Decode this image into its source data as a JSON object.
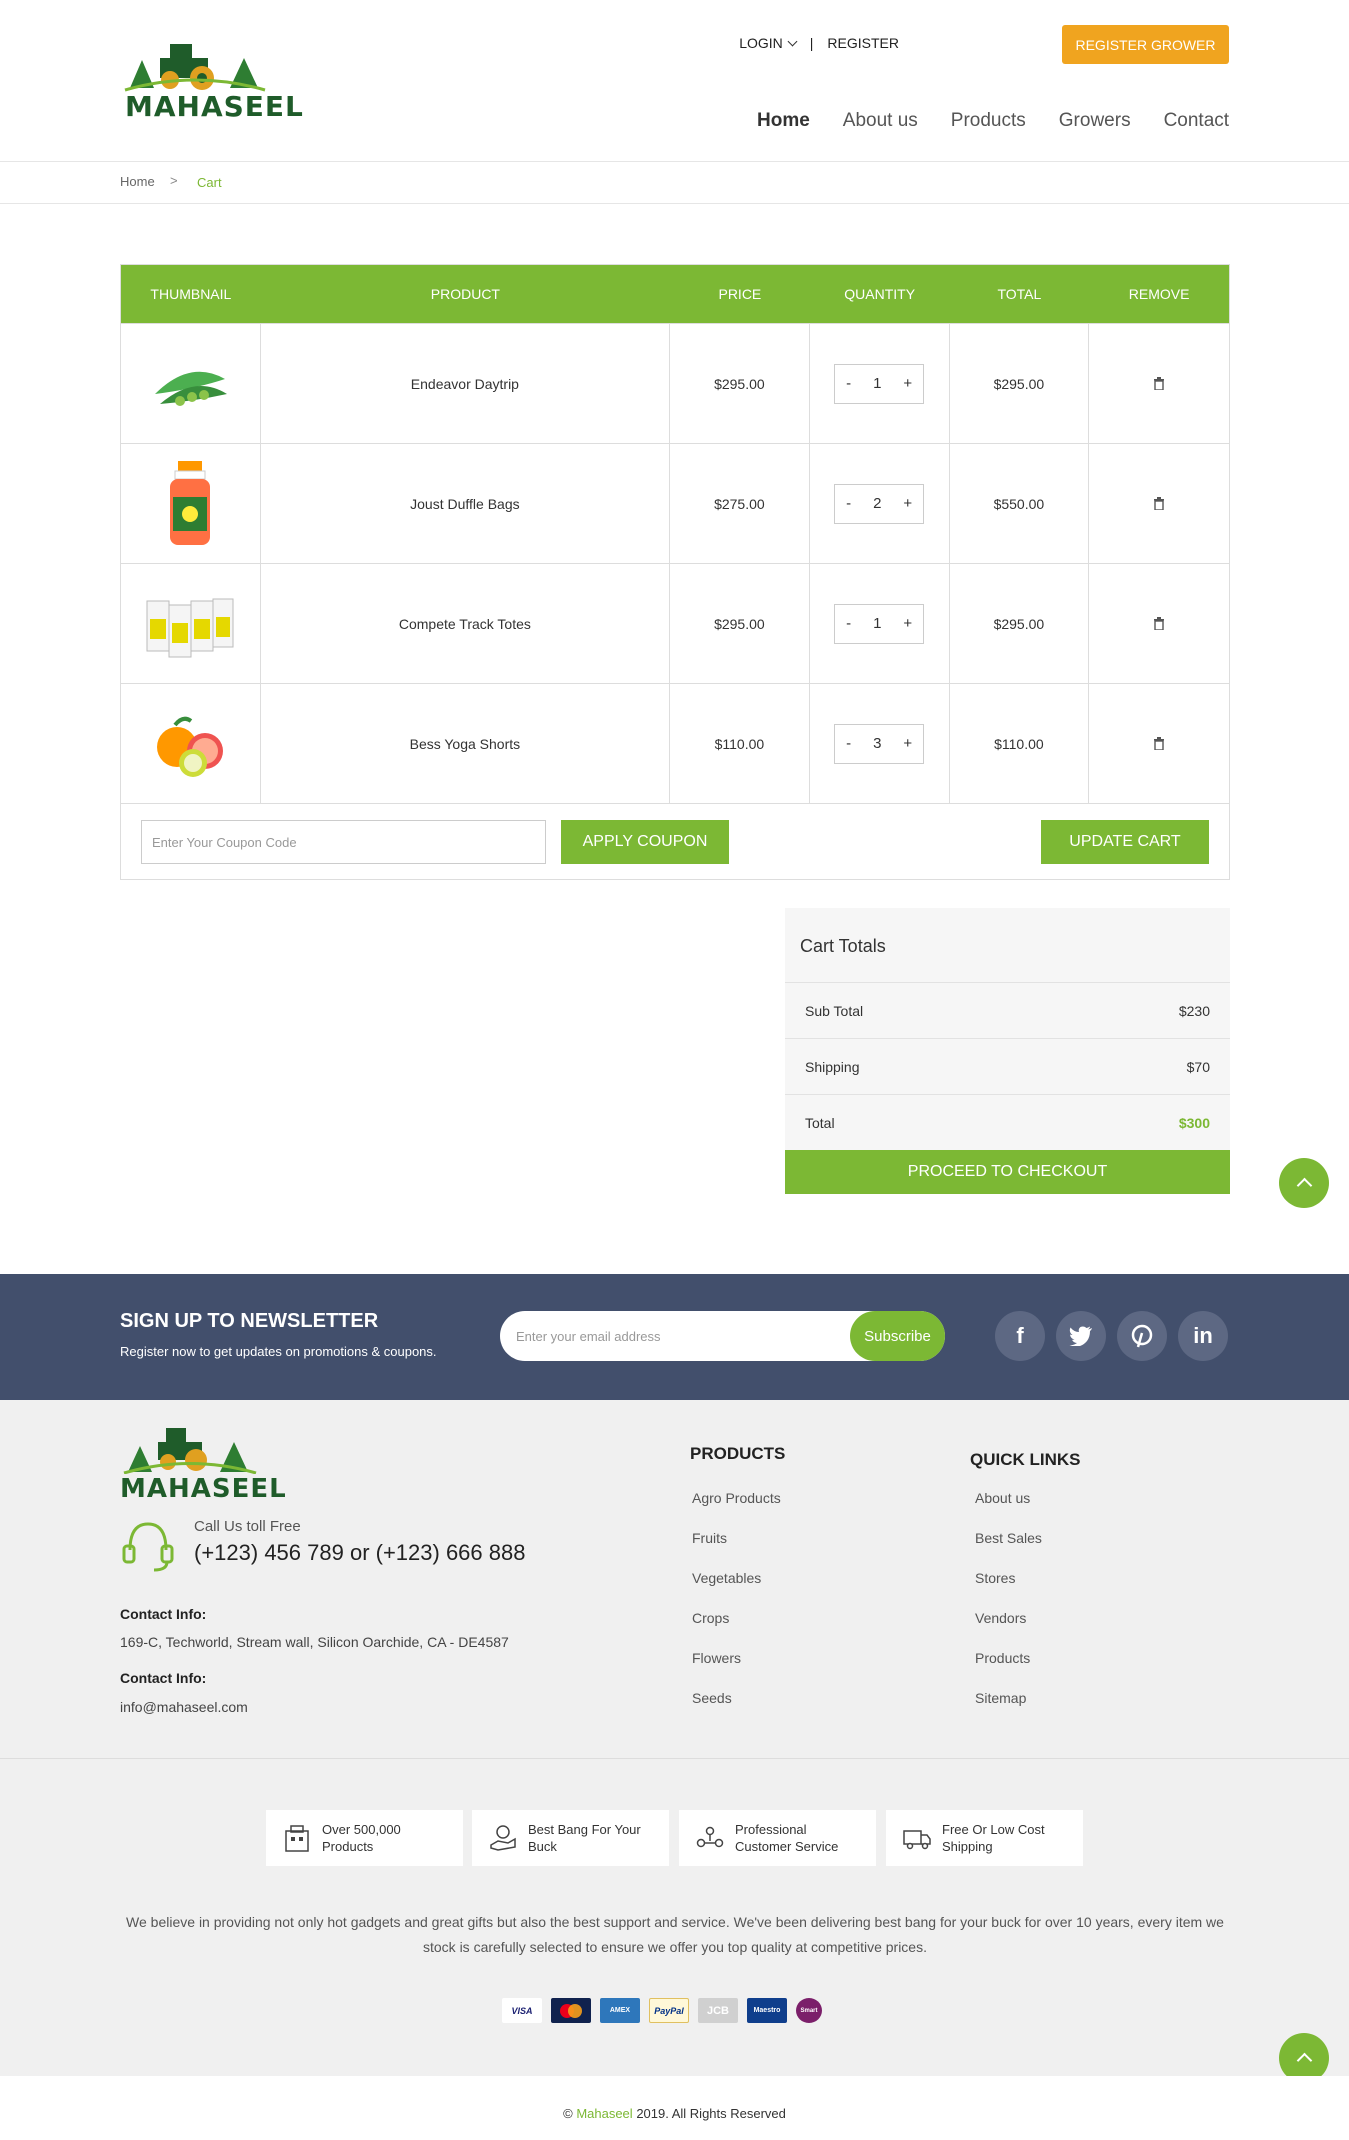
{
  "header": {
    "brand": "MAHASEEL",
    "login": "LOGIN",
    "register": "REGISTER",
    "register_grower": "REGISTER GROWER",
    "nav": [
      "Home",
      "About us",
      "Products",
      "Growers",
      "Contact"
    ]
  },
  "breadcrumb": {
    "home": "Home",
    "sep": ">",
    "current": "Cart"
  },
  "cart": {
    "headers": [
      "THUMBNAIL",
      "PRODUCT",
      "PRICE",
      "QUANTITY",
      "TOTAL",
      "REMOVE"
    ],
    "rows": [
      {
        "product": "Endeavor Daytrip",
        "price": "$295.00",
        "qty": "1",
        "total": "$295.00"
      },
      {
        "product": "Joust Duffle Bags",
        "price": "$275.00",
        "qty": "2",
        "total": "$550.00"
      },
      {
        "product": "Compete Track Totes",
        "price": "$295.00",
        "qty": "1",
        "total": "$295.00"
      },
      {
        "product": "Bess Yoga Shorts",
        "price": "$110.00",
        "qty": "3",
        "total": "$110.00"
      }
    ],
    "qty_minus": "-",
    "qty_plus": "+",
    "coupon_placeholder": "Enter Your Coupon Code",
    "apply_coupon": "APPLY COUPON",
    "update_cart": "UPDATE CART"
  },
  "totals": {
    "title": "Cart Totals",
    "subtotal_label": "Sub Total",
    "subtotal": "$230",
    "shipping_label": "Shipping",
    "shipping": "$70",
    "total_label": "Total",
    "total": "$300",
    "checkout": "PROCEED TO CHECKOUT"
  },
  "newsletter": {
    "title": "SIGN UP TO NEWSLETTER",
    "subtitle": "Register now to get updates on promotions & coupons.",
    "placeholder": "Enter your email address",
    "subscribe": "Subscribe",
    "social": [
      "f",
      "t",
      "p",
      "in"
    ]
  },
  "footer": {
    "brand": "MAHASEEL",
    "call_label": "Call Us toll Free",
    "call_number": "(+123) 456 789 or (+123) 666 888",
    "contact1_label": "Contact Info:",
    "contact1_text": "169-C, Techworld, Stream wall, Silicon Oarchide, CA - DE4587",
    "contact2_label": "Contact Info:",
    "contact2_text": "info@mahaseel.com",
    "products_title": "PRODUCTS",
    "products": [
      "Agro Products",
      "Fruits",
      "Vegetables",
      "Crops",
      "Flowers",
      "Seeds"
    ],
    "quick_title": "QUICK LINKS",
    "quick": [
      "About us",
      "Best Sales",
      "Stores",
      "Vendors",
      "Products",
      "Sitemap"
    ],
    "features": [
      {
        "line1": "Over 500,000",
        "line2": "Products"
      },
      {
        "line1": "Best Bang For Your",
        "line2": "Buck"
      },
      {
        "line1": "Professional",
        "line2": "Customer Service"
      },
      {
        "line1": "Free Or Low Cost",
        "line2": "Shipping"
      }
    ],
    "about": "We believe in providing not only hot gadgets and great gifts but also the best support and service. We've been delivering best bang for your buck for over 10 years, every item we stock is carefully selected to ensure we offer you top quality at competitive prices.",
    "payments": [
      "VISA",
      "MC",
      "AMEX",
      "PayPal",
      "JCB",
      "Maestro",
      "Smart"
    ],
    "copyright_prefix": "©",
    "copyright_brand": "Mahaseel",
    "copyright_suffix": "2019. All Rights Reserved"
  },
  "colors": {
    "accent": "#7cb834",
    "orange": "#f0a41f",
    "newsletter_bg": "#424f6c"
  }
}
